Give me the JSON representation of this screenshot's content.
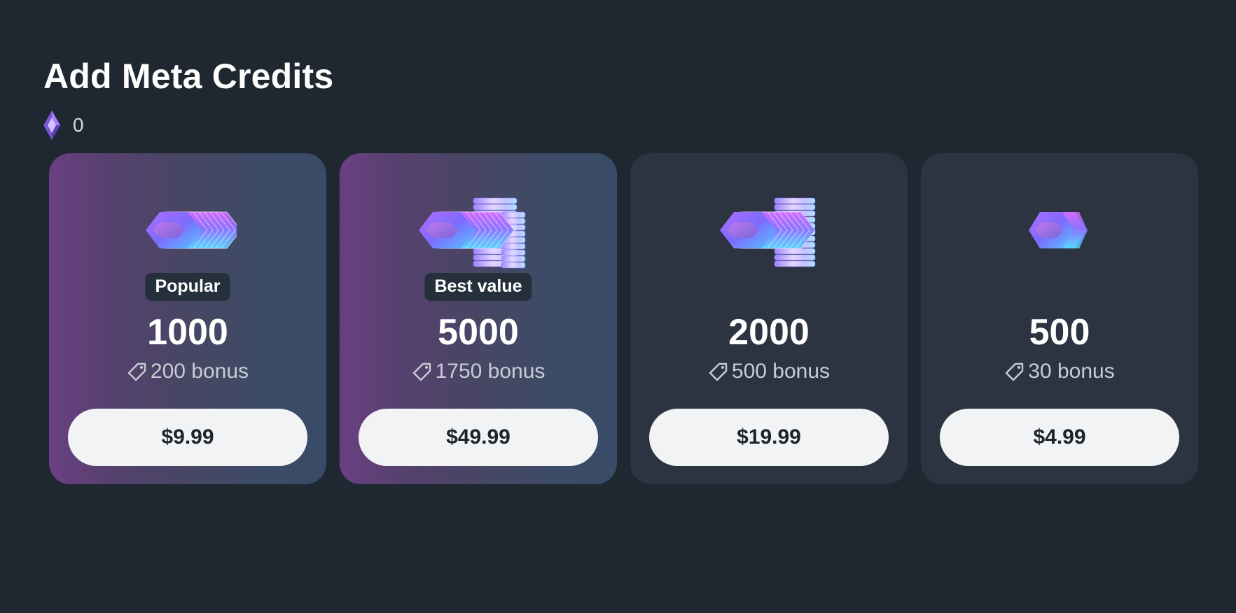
{
  "header": {
    "title": "Add Meta Credits",
    "balance": "0",
    "balance_icon": "meta-credit-gem-icon"
  },
  "colors": {
    "background": "#1f2731",
    "featured_card_start": "#6b3f82",
    "featured_card_end": "#394b67",
    "standard_card": "#2b3440",
    "button": "#f2f3f5",
    "button_text": "#1d232b",
    "badge": "#25303c"
  },
  "packages": [
    {
      "badge": "Popular",
      "amount": "1000",
      "bonus": "200 bonus",
      "price": "$9.99",
      "icon": "credit-crystal-stack-icon",
      "bonus_icon": "tag-icon"
    },
    {
      "badge": "Best value",
      "amount": "5000",
      "bonus": "1750 bonus",
      "price": "$49.99",
      "icon": "credit-crystal-tower-icon",
      "bonus_icon": "tag-icon"
    },
    {
      "amount": "2000",
      "bonus": "500 bonus",
      "price": "$19.99",
      "icon": "credit-crystal-pile-icon",
      "bonus_icon": "tag-icon"
    },
    {
      "amount": "500",
      "bonus": "30 bonus",
      "price": "$4.99",
      "icon": "credit-crystal-icon",
      "bonus_icon": "tag-icon"
    }
  ]
}
